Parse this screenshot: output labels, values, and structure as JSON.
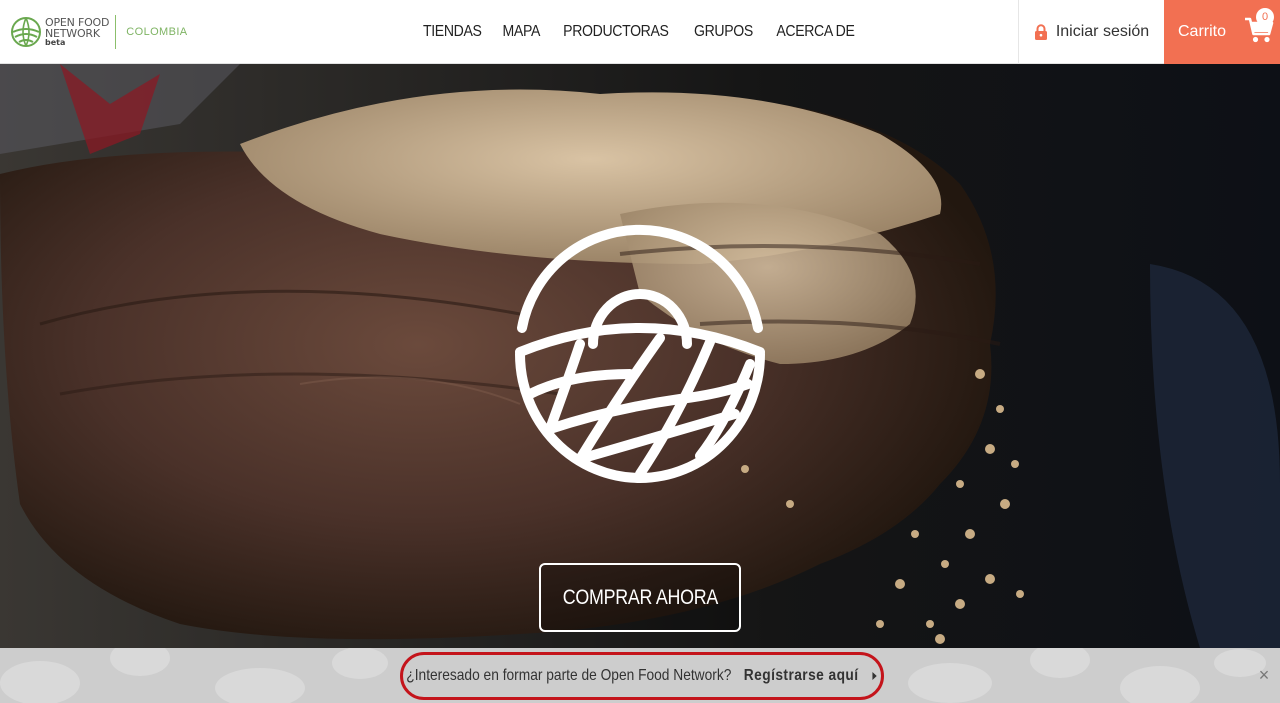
{
  "brand": {
    "line1": "OPEN FOOD",
    "line2": "NETWORK",
    "line3": "beta",
    "region": "COLOMBIA"
  },
  "nav": {
    "items": [
      "TIENDAS",
      "MAPA",
      "PRODUCTORAS",
      "GRUPOS",
      "ACERCA DE"
    ]
  },
  "header": {
    "login_label": "Iniciar sesión",
    "cart_label": "Carrito",
    "cart_count": "0"
  },
  "hero": {
    "cta_label": "COMPRAR AHORA"
  },
  "banner": {
    "text": "¿Interesado en formar parte de Open Food Network?",
    "link_label": "Regístrarse aquí",
    "close_label": "×"
  },
  "colors": {
    "accent": "#f27052",
    "brand_green": "#7fb464",
    "highlight_ring": "#c4141b"
  },
  "icons": [
    "ofn-logo-icon",
    "lock-icon",
    "cart-icon",
    "basket-icon",
    "arrow-right-icon",
    "close-icon"
  ]
}
